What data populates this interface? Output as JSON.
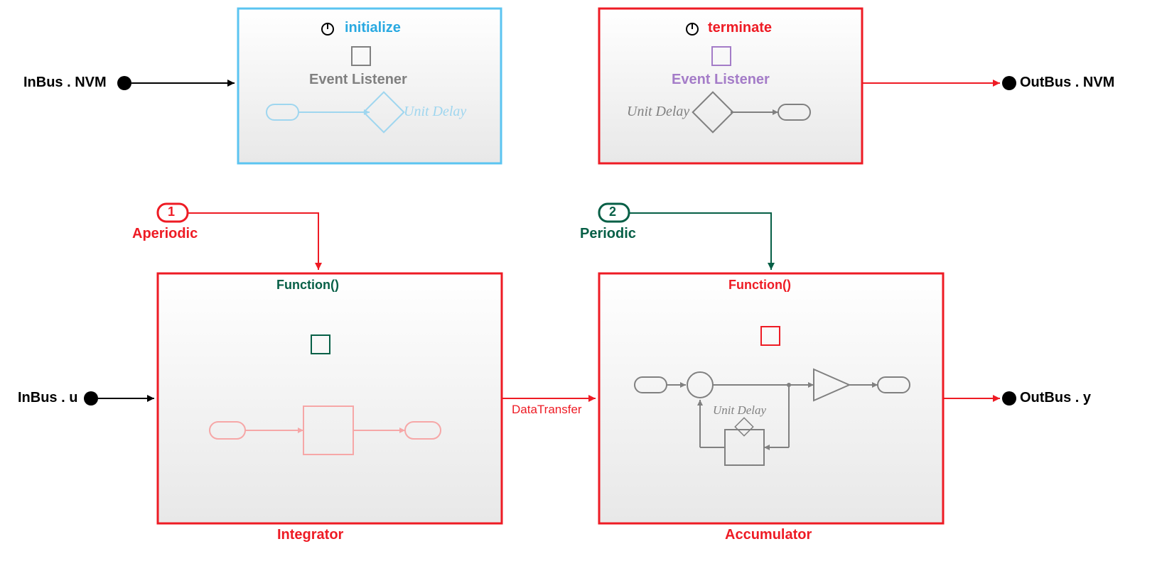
{
  "ports": {
    "inbus_nvm": "InBus . NVM",
    "outbus_nvm": "OutBus . NVM",
    "inbus_u": "InBus . u",
    "outbus_y": "OutBus . y"
  },
  "blocks": {
    "initialize": {
      "title": "initialize",
      "event_listener": "Event Listener",
      "unit_delay": "Unit Delay"
    },
    "terminate": {
      "title": "terminate",
      "event_listener": "Event Listener",
      "unit_delay": "Unit Delay"
    },
    "integrator": {
      "function": "Function()",
      "name": "Integrator"
    },
    "accumulator": {
      "function": "Function()",
      "name": "Accumulator",
      "unit_delay": "Unit Delay"
    }
  },
  "triggers": {
    "aperiodic_num": "1",
    "aperiodic_label": "Aperiodic",
    "periodic_num": "2",
    "periodic_label": "Periodic"
  },
  "signals": {
    "data_transfer": "DataTransfer"
  },
  "colors": {
    "red": "#ee1b24",
    "green": "#065f46",
    "blue_border": "#5bc4f1",
    "blue_text": "#29a9e1",
    "purple": "#a47cc8",
    "grey": "#808080",
    "light_grey": "#bfbfbf"
  }
}
